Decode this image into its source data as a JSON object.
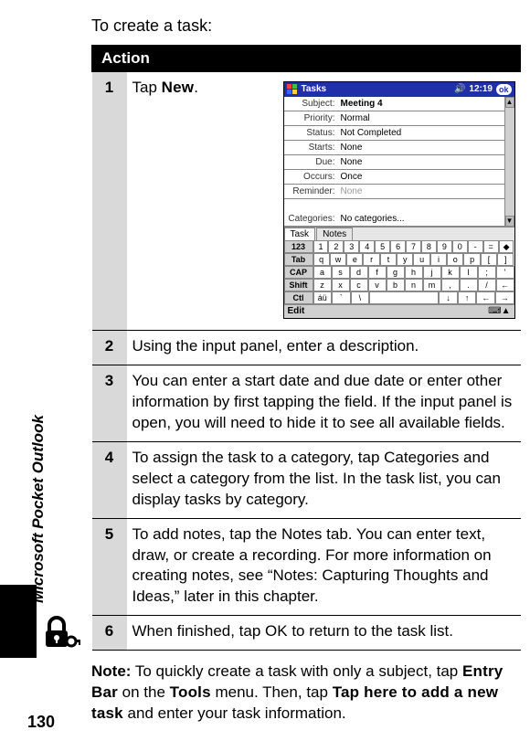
{
  "side_label": "Microsoft Pocket Outlook",
  "intro": "To create a task:",
  "table_header": "Action",
  "steps": {
    "s1": {
      "num": "1",
      "text_a": "Tap ",
      "text_b": "."
    },
    "s2": {
      "num": "2",
      "text": "Using the input panel, enter a description."
    },
    "s3": {
      "num": "3",
      "text": "You can enter a start date and due date or enter other information by first tapping the field. If the input panel is open, you will need to hide it to see all available fields."
    },
    "s4": {
      "num": "4",
      "text": "To assign the task to a category, tap Categories and select a category from the list. In the task list, you can display tasks by category."
    },
    "s5": {
      "num": "5",
      "text": "To add notes, tap the Notes tab. You can enter text, draw, or create a recording. For more information on creating notes, see “Notes: Capturing Thoughts and Ideas,” later in this chapter."
    },
    "s6": {
      "num": "6",
      "text": "When finished, tap OK to return to the task list."
    }
  },
  "ui": {
    "new": "New",
    "entry_bar": "Entry Bar",
    "tools": "Tools",
    "tap_here": "Tap here to add a new task"
  },
  "note_parts": {
    "label": "Note:",
    "p1": " To quickly create a task with only a subject, tap ",
    "p2": " on the ",
    "p3": " menu. Then, tap ",
    "p4": " and enter your task information."
  },
  "page_number": "130",
  "pda": {
    "title": "Tasks",
    "time": "12:19",
    "ok": "ok",
    "fields": {
      "subject": {
        "lbl": "Subject:",
        "val": "Meeting 4"
      },
      "priority": {
        "lbl": "Priority:",
        "val": "Normal"
      },
      "status": {
        "lbl": "Status:",
        "val": "Not Completed"
      },
      "starts": {
        "lbl": "Starts:",
        "val": "None"
      },
      "due": {
        "lbl": "Due:",
        "val": "None"
      },
      "occurs": {
        "lbl": "Occurs:",
        "val": "Once"
      },
      "reminder": {
        "lbl": "Reminder:",
        "val": "None"
      },
      "categories": {
        "lbl": "Categories:",
        "val": "No categories..."
      }
    },
    "tabs": {
      "task": "Task",
      "notes": "Notes"
    },
    "kbd": {
      "r1": [
        "123",
        "1",
        "2",
        "3",
        "4",
        "5",
        "6",
        "7",
        "8",
        "9",
        "0",
        "-",
        "=",
        "◆"
      ],
      "r2": [
        "Tab",
        "q",
        "w",
        "e",
        "r",
        "t",
        "y",
        "u",
        "i",
        "o",
        "p",
        "[",
        "]"
      ],
      "r3": [
        "CAP",
        "a",
        "s",
        "d",
        "f",
        "g",
        "h",
        "j",
        "k",
        "l",
        ";",
        "'"
      ],
      "r4": [
        "Shift",
        "z",
        "x",
        "c",
        "v",
        "b",
        "n",
        "m",
        ",",
        ".",
        "/",
        "←"
      ],
      "r5": [
        "Ctl",
        "áü",
        "`",
        "\\",
        " ",
        "↓",
        "↑",
        "←",
        "→"
      ]
    },
    "edit": "Edit"
  }
}
